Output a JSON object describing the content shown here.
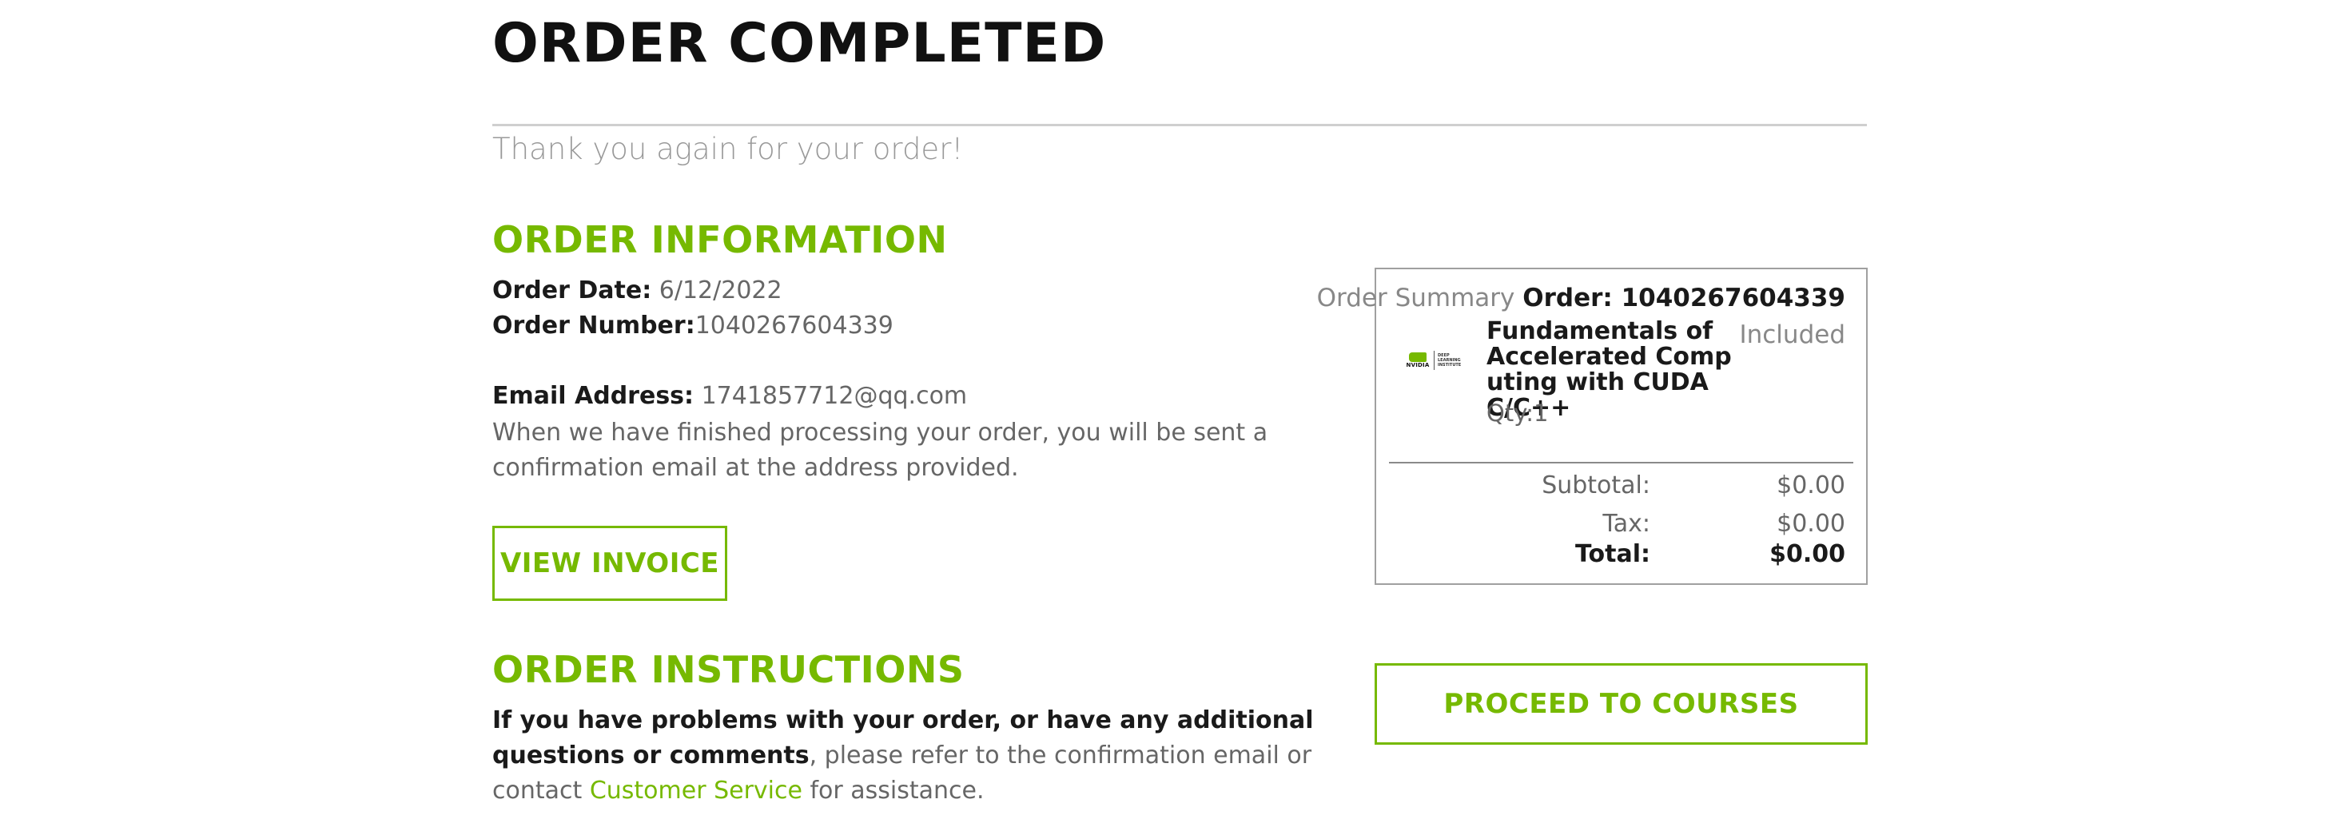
{
  "page": {
    "title": "ORDER COMPLETED",
    "thanks": "Thank you again for your order!"
  },
  "order_info": {
    "heading": "ORDER INFORMATION",
    "date_label": "Order Date:",
    "date_value": "6/12/2022",
    "number_label": "Order Number:",
    "number_value": "1040267604339",
    "email_label": "Email Address:",
    "email_value": "1741857712@qq.com",
    "email_note": "When we have finished processing your order, you will be sent a confirmation email at the address provided.",
    "view_invoice_label": "VIEW INVOICE"
  },
  "summary": {
    "label": "Order Summary",
    "order_ref": "Order: 1040267604339",
    "product": {
      "name": "Fundamentals of Accelerated Computing with CUDA C/C++",
      "qty": "Qty:1",
      "price": "Included",
      "logo_word": "NVIDIA",
      "logo_text": "DEEP LEARNING INSTITUTE"
    },
    "subtotal_label": "Subtotal:",
    "subtotal_value": "$0.00",
    "tax_label": "Tax:",
    "tax_value": "$0.00",
    "total_label": "Total:",
    "total_value": "$0.00",
    "proceed_label": "PROCEED TO COURSES"
  },
  "instructions": {
    "heading": "ORDER INSTRUCTIONS",
    "bold_text": "If you have problems with your order, or have any additional questions or comments",
    "text_mid": ", please refer to the confirmation email or contact ",
    "link_text": "Customer Service",
    "text_end": " for assistance."
  },
  "colors": {
    "accent": "#76b900",
    "text": "#1a1a1a",
    "muted": "#666666",
    "border": "#a0a0a0"
  }
}
